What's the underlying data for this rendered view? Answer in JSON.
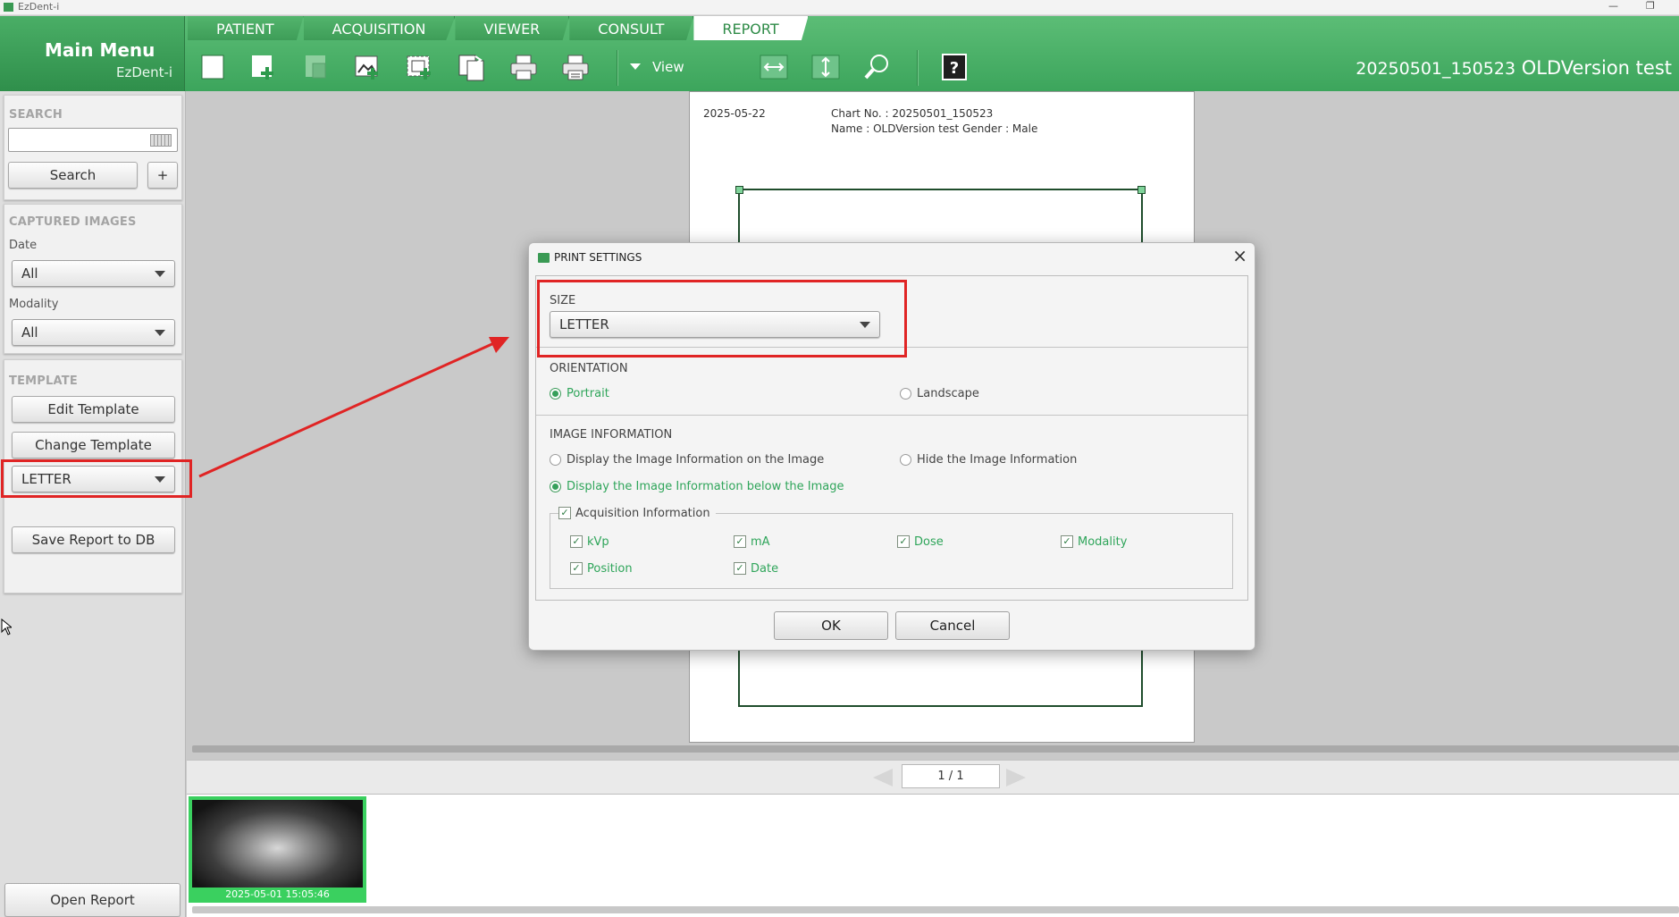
{
  "app": {
    "title": "EzDent-i",
    "min_icon": "minimize-icon",
    "restore_icon": "restore-icon"
  },
  "mainmenu": {
    "title": "Main Menu",
    "sub": "EzDent-i"
  },
  "tabs": [
    {
      "label": "PATIENT"
    },
    {
      "label": "ACQUISITION"
    },
    {
      "label": "VIEWER"
    },
    {
      "label": "CONSULT"
    },
    {
      "label": "REPORT"
    }
  ],
  "toolbar": {
    "view_label": "View"
  },
  "patient_header": {
    "chart_id": "20250501_150523",
    "name": "OLDVersion test"
  },
  "left": {
    "search": {
      "heading": "SEARCH",
      "input_value": "",
      "search_label": "Search",
      "plus_label": "+"
    },
    "captured": {
      "heading": "CAPTURED IMAGES",
      "date_label": "Date",
      "date_value": "All",
      "modality_label": "Modality",
      "modality_value": "All"
    },
    "template": {
      "heading": "TEMPLATE",
      "edit_label": "Edit Template",
      "change_label": "Change Template",
      "size_value": "LETTER"
    },
    "save_label": "Save Report to DB",
    "open_label": "Open Report"
  },
  "report_page": {
    "date": "2025-05-22",
    "chart_line": "Chart No. : 20250501_150523",
    "name_line": "Name : OLDVersion test Gender : Male"
  },
  "pager": {
    "text": "1 / 1"
  },
  "thumbnail": {
    "caption": "2025-05-01 15:05:46"
  },
  "dialog": {
    "title": "PRINT SETTINGS",
    "size_label": "SIZE",
    "size_value": "LETTER",
    "orientation_label": "ORIENTATION",
    "portrait": "Portrait",
    "landscape": "Landscape",
    "imginfo_label": "IMAGE INFORMATION",
    "opt_on_image": "Display the Image Information on the Image",
    "opt_hide": "Hide the Image Information",
    "opt_below": "Display the Image Information below the Image",
    "acq_label": "Acquisition Information",
    "checks": [
      "kVp",
      "mA",
      "Dose",
      "Modality",
      "Position",
      "Date"
    ],
    "ok": "OK",
    "cancel": "Cancel"
  },
  "colors": {
    "brand_green": "#3ca55c",
    "accent_green": "#2fa55a",
    "annotation_red": "#e02424"
  }
}
